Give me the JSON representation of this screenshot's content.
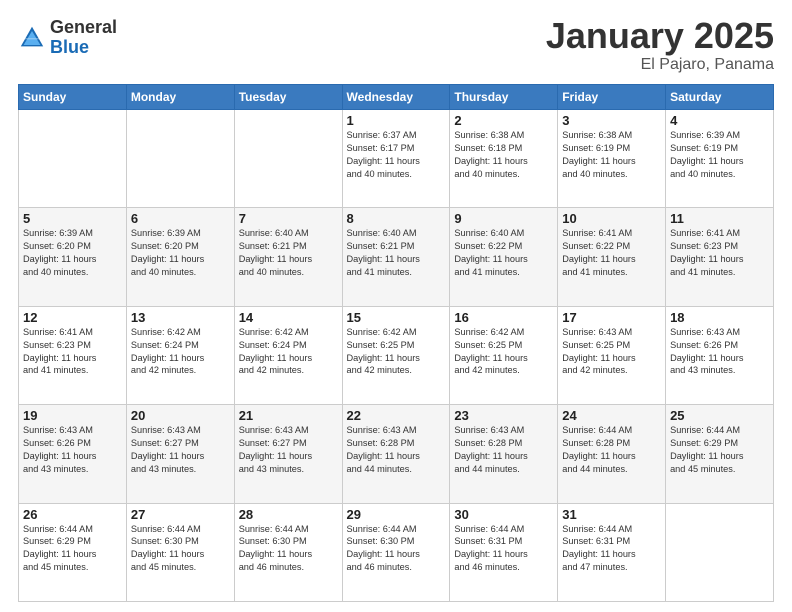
{
  "logo": {
    "line1": "General",
    "line2": "Blue"
  },
  "header": {
    "month": "January 2025",
    "location": "El Pajaro, Panama"
  },
  "days_of_week": [
    "Sunday",
    "Monday",
    "Tuesday",
    "Wednesday",
    "Thursday",
    "Friday",
    "Saturday"
  ],
  "weeks": [
    [
      {
        "day": "",
        "info": ""
      },
      {
        "day": "",
        "info": ""
      },
      {
        "day": "",
        "info": ""
      },
      {
        "day": "1",
        "info": "Sunrise: 6:37 AM\nSunset: 6:17 PM\nDaylight: 11 hours\nand 40 minutes."
      },
      {
        "day": "2",
        "info": "Sunrise: 6:38 AM\nSunset: 6:18 PM\nDaylight: 11 hours\nand 40 minutes."
      },
      {
        "day": "3",
        "info": "Sunrise: 6:38 AM\nSunset: 6:19 PM\nDaylight: 11 hours\nand 40 minutes."
      },
      {
        "day": "4",
        "info": "Sunrise: 6:39 AM\nSunset: 6:19 PM\nDaylight: 11 hours\nand 40 minutes."
      }
    ],
    [
      {
        "day": "5",
        "info": "Sunrise: 6:39 AM\nSunset: 6:20 PM\nDaylight: 11 hours\nand 40 minutes."
      },
      {
        "day": "6",
        "info": "Sunrise: 6:39 AM\nSunset: 6:20 PM\nDaylight: 11 hours\nand 40 minutes."
      },
      {
        "day": "7",
        "info": "Sunrise: 6:40 AM\nSunset: 6:21 PM\nDaylight: 11 hours\nand 40 minutes."
      },
      {
        "day": "8",
        "info": "Sunrise: 6:40 AM\nSunset: 6:21 PM\nDaylight: 11 hours\nand 41 minutes."
      },
      {
        "day": "9",
        "info": "Sunrise: 6:40 AM\nSunset: 6:22 PM\nDaylight: 11 hours\nand 41 minutes."
      },
      {
        "day": "10",
        "info": "Sunrise: 6:41 AM\nSunset: 6:22 PM\nDaylight: 11 hours\nand 41 minutes."
      },
      {
        "day": "11",
        "info": "Sunrise: 6:41 AM\nSunset: 6:23 PM\nDaylight: 11 hours\nand 41 minutes."
      }
    ],
    [
      {
        "day": "12",
        "info": "Sunrise: 6:41 AM\nSunset: 6:23 PM\nDaylight: 11 hours\nand 41 minutes."
      },
      {
        "day": "13",
        "info": "Sunrise: 6:42 AM\nSunset: 6:24 PM\nDaylight: 11 hours\nand 42 minutes."
      },
      {
        "day": "14",
        "info": "Sunrise: 6:42 AM\nSunset: 6:24 PM\nDaylight: 11 hours\nand 42 minutes."
      },
      {
        "day": "15",
        "info": "Sunrise: 6:42 AM\nSunset: 6:25 PM\nDaylight: 11 hours\nand 42 minutes."
      },
      {
        "day": "16",
        "info": "Sunrise: 6:42 AM\nSunset: 6:25 PM\nDaylight: 11 hours\nand 42 minutes."
      },
      {
        "day": "17",
        "info": "Sunrise: 6:43 AM\nSunset: 6:25 PM\nDaylight: 11 hours\nand 42 minutes."
      },
      {
        "day": "18",
        "info": "Sunrise: 6:43 AM\nSunset: 6:26 PM\nDaylight: 11 hours\nand 43 minutes."
      }
    ],
    [
      {
        "day": "19",
        "info": "Sunrise: 6:43 AM\nSunset: 6:26 PM\nDaylight: 11 hours\nand 43 minutes."
      },
      {
        "day": "20",
        "info": "Sunrise: 6:43 AM\nSunset: 6:27 PM\nDaylight: 11 hours\nand 43 minutes."
      },
      {
        "day": "21",
        "info": "Sunrise: 6:43 AM\nSunset: 6:27 PM\nDaylight: 11 hours\nand 43 minutes."
      },
      {
        "day": "22",
        "info": "Sunrise: 6:43 AM\nSunset: 6:28 PM\nDaylight: 11 hours\nand 44 minutes."
      },
      {
        "day": "23",
        "info": "Sunrise: 6:43 AM\nSunset: 6:28 PM\nDaylight: 11 hours\nand 44 minutes."
      },
      {
        "day": "24",
        "info": "Sunrise: 6:44 AM\nSunset: 6:28 PM\nDaylight: 11 hours\nand 44 minutes."
      },
      {
        "day": "25",
        "info": "Sunrise: 6:44 AM\nSunset: 6:29 PM\nDaylight: 11 hours\nand 45 minutes."
      }
    ],
    [
      {
        "day": "26",
        "info": "Sunrise: 6:44 AM\nSunset: 6:29 PM\nDaylight: 11 hours\nand 45 minutes."
      },
      {
        "day": "27",
        "info": "Sunrise: 6:44 AM\nSunset: 6:30 PM\nDaylight: 11 hours\nand 45 minutes."
      },
      {
        "day": "28",
        "info": "Sunrise: 6:44 AM\nSunset: 6:30 PM\nDaylight: 11 hours\nand 46 minutes."
      },
      {
        "day": "29",
        "info": "Sunrise: 6:44 AM\nSunset: 6:30 PM\nDaylight: 11 hours\nand 46 minutes."
      },
      {
        "day": "30",
        "info": "Sunrise: 6:44 AM\nSunset: 6:31 PM\nDaylight: 11 hours\nand 46 minutes."
      },
      {
        "day": "31",
        "info": "Sunrise: 6:44 AM\nSunset: 6:31 PM\nDaylight: 11 hours\nand 47 minutes."
      },
      {
        "day": "",
        "info": ""
      }
    ]
  ]
}
